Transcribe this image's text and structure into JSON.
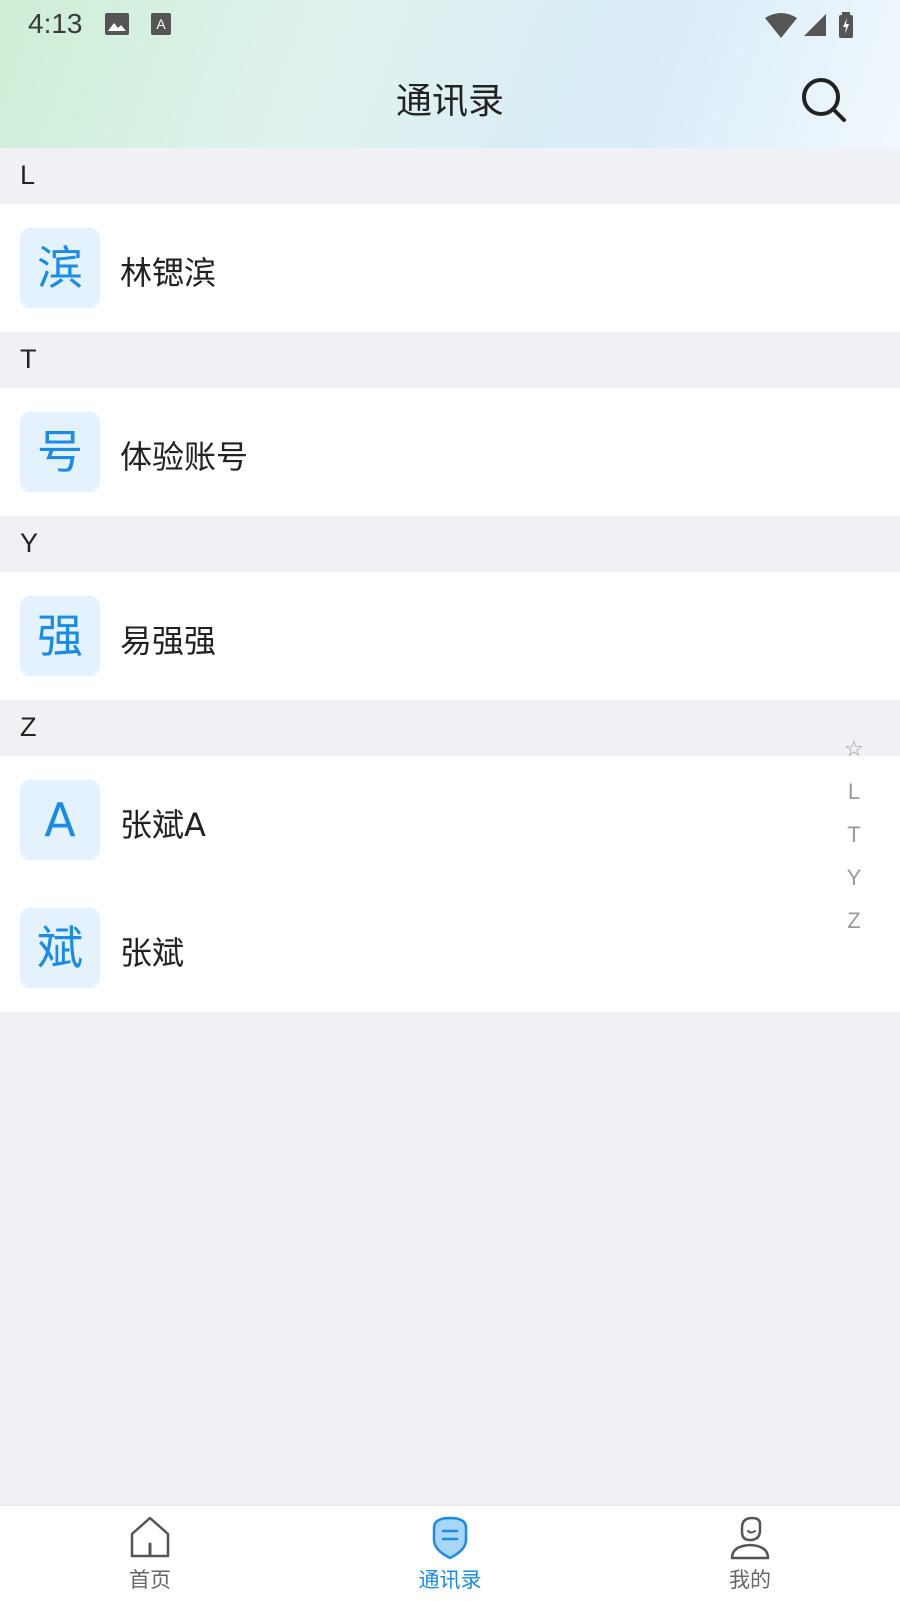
{
  "status_bar": {
    "time": "4:13"
  },
  "header": {
    "title": "通讯录"
  },
  "sections": [
    {
      "letter": "L",
      "contacts": [
        {
          "avatar": "滨",
          "name": "林锶滨"
        }
      ]
    },
    {
      "letter": "T",
      "contacts": [
        {
          "avatar": "号",
          "name": "体验账号"
        }
      ]
    },
    {
      "letter": "Y",
      "contacts": [
        {
          "avatar": "强",
          "name": "易强强"
        }
      ]
    },
    {
      "letter": "Z",
      "contacts": [
        {
          "avatar": "A",
          "name": "张斌A"
        },
        {
          "avatar": "斌",
          "name": "张斌"
        }
      ]
    }
  ],
  "index_bar": [
    "☆",
    "L",
    "T",
    "Y",
    "Z"
  ],
  "bottom_nav": [
    {
      "label": "首页",
      "icon": "home-icon",
      "active": false
    },
    {
      "label": "通讯录",
      "icon": "contacts-icon",
      "active": true
    },
    {
      "label": "我的",
      "icon": "profile-icon",
      "active": false
    }
  ],
  "colors": {
    "accent": "#1a8ce6",
    "avatar_bg": "#e3f2fc",
    "page_bg": "#eff1f5"
  }
}
